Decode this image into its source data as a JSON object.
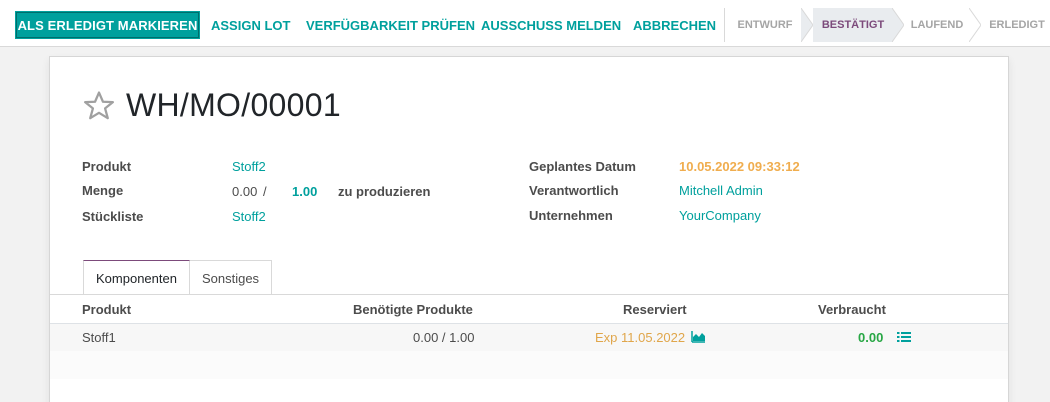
{
  "toolbar": {
    "mark_done": "ALS ERLEDIGT MARKIEREN",
    "assign_lot": "ASSIGN LOT",
    "check_availability": "VERFÜGBARKEIT PRÜFEN",
    "report_scrap": "AUSSCHUSS MELDEN",
    "cancel": "ABBRECHEN"
  },
  "statusbar": {
    "stages": [
      "ENTWURF",
      "BESTÄTIGT",
      "LAUFEND",
      "ERLEDIGT"
    ],
    "active": "BESTÄTIGT"
  },
  "record": {
    "title": "WH/MO/00001",
    "fields_left": {
      "product_label": "Produkt",
      "product_value": "Stoff2",
      "quantity_label": "Menge",
      "quantity_done": "0.00",
      "quantity_sep": "/",
      "quantity_total": "1.00",
      "quantity_suffix": "zu produzieren",
      "bom_label": "Stückliste",
      "bom_value": "Stoff2"
    },
    "fields_right": {
      "date_label": "Geplantes Datum",
      "date_value": "10.05.2022 09:33:12",
      "responsible_label": "Verantwortlich",
      "responsible_value": "Mitchell Admin",
      "company_label": "Unternehmen",
      "company_value": "YourCompany"
    }
  },
  "tabs": [
    "Komponenten",
    "Sonstiges"
  ],
  "components_table": {
    "columns": [
      "Produkt",
      "Benötigte Produkte",
      "Reserviert",
      "Verbraucht"
    ],
    "rows": [
      {
        "product": "Stoff1",
        "required": "0.00 / 1.00",
        "reserved": "Exp 11.05.2022",
        "consumed": "0.00"
      }
    ]
  },
  "colors": {
    "primary": "#00a09d",
    "active_stage": "#7c4a7b",
    "warning": "#f0ad4e",
    "success": "#28a745"
  }
}
